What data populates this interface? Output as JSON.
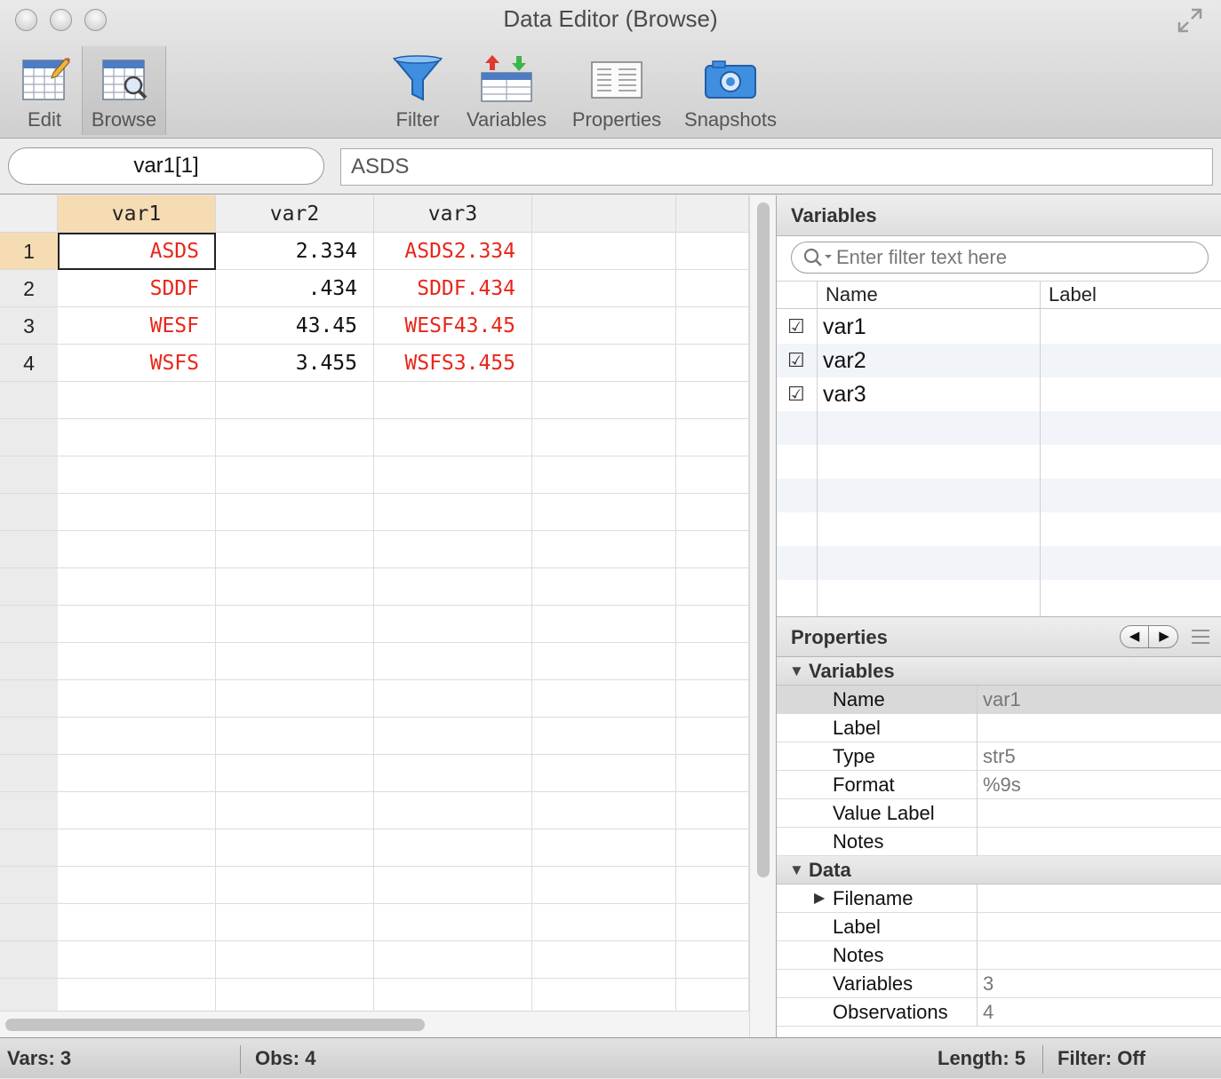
{
  "window": {
    "title": "Data Editor (Browse)"
  },
  "toolbar": {
    "edit": "Edit",
    "browse": "Browse",
    "filter": "Filter",
    "variables": "Variables",
    "properties": "Properties",
    "snapshots": "Snapshots"
  },
  "refbar": {
    "cell_ref": "var1[1]",
    "cell_value": "ASDS"
  },
  "grid": {
    "columns": [
      "var1",
      "var2",
      "var3"
    ],
    "rows": [
      {
        "n": "1",
        "var1": "ASDS",
        "var2": "2.334",
        "var3": "ASDS2.334"
      },
      {
        "n": "2",
        "var1": "SDDF",
        "var2": ".434",
        "var3": "SDDF.434"
      },
      {
        "n": "3",
        "var1": "WESF",
        "var2": "43.45",
        "var3": "WESF43.45"
      },
      {
        "n": "4",
        "var1": "WSFS",
        "var2": "3.455",
        "var3": "WSFS3.455"
      }
    ]
  },
  "variables_panel": {
    "title": "Variables",
    "filter_placeholder": "Enter filter text here",
    "col_name": "Name",
    "col_label": "Label",
    "items": [
      {
        "name": "var1",
        "checked": "☑"
      },
      {
        "name": "var2",
        "checked": "☑"
      },
      {
        "name": "var3",
        "checked": "☑"
      }
    ]
  },
  "properties_panel": {
    "title": "Properties",
    "variables_group": "Variables",
    "var_props": [
      {
        "key": "Name",
        "value": "var1"
      },
      {
        "key": "Label",
        "value": ""
      },
      {
        "key": "Type",
        "value": "str5"
      },
      {
        "key": "Format",
        "value": "%9s"
      },
      {
        "key": "Value Label",
        "value": ""
      },
      {
        "key": "Notes",
        "value": ""
      }
    ],
    "data_group": "Data",
    "data_props": [
      {
        "key": "Filename",
        "value": ""
      },
      {
        "key": "Label",
        "value": ""
      },
      {
        "key": "Notes",
        "value": ""
      },
      {
        "key": "Variables",
        "value": "3"
      },
      {
        "key": "Observations",
        "value": "4"
      }
    ]
  },
  "statusbar": {
    "vars": "Vars: 3",
    "obs": "Obs: 4",
    "length": "Length: 5",
    "filter": "Filter: Off"
  },
  "colors": {
    "string_cell": "#e8261a",
    "selected_header": "#f5dcb3"
  }
}
